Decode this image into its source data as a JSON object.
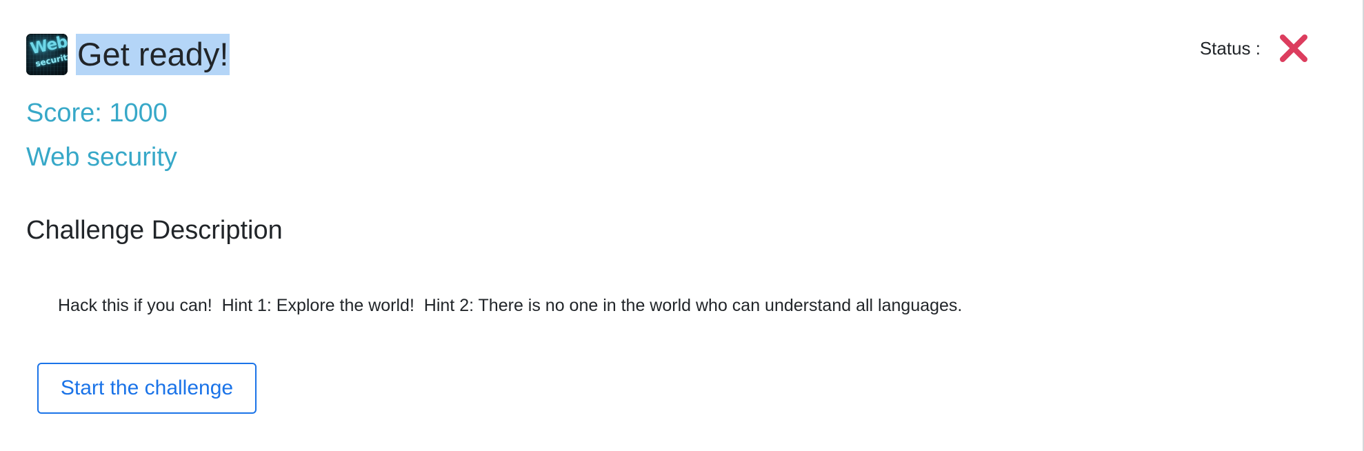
{
  "header": {
    "logo_icon": "web-security-logo",
    "logo_text_line1": "Web",
    "logo_text_line2": "security",
    "title": "Get ready!"
  },
  "status": {
    "label": "Status :",
    "icon": "cross-icon",
    "color": "#dc3d5e"
  },
  "challenge": {
    "score": "Score: 1000",
    "category": "Web security",
    "section_heading": "Challenge Description",
    "description": "Hack this if you can!  Hint 1: Explore the world!  Hint 2: There is no one in the world who can understand all languages."
  },
  "actions": {
    "start_label": "Start the challenge"
  },
  "colors": {
    "accent_teal": "#37a8c8",
    "button_blue": "#1a73e8",
    "selection_highlight": "#b4d5f7",
    "status_red": "#dc3d5e"
  }
}
